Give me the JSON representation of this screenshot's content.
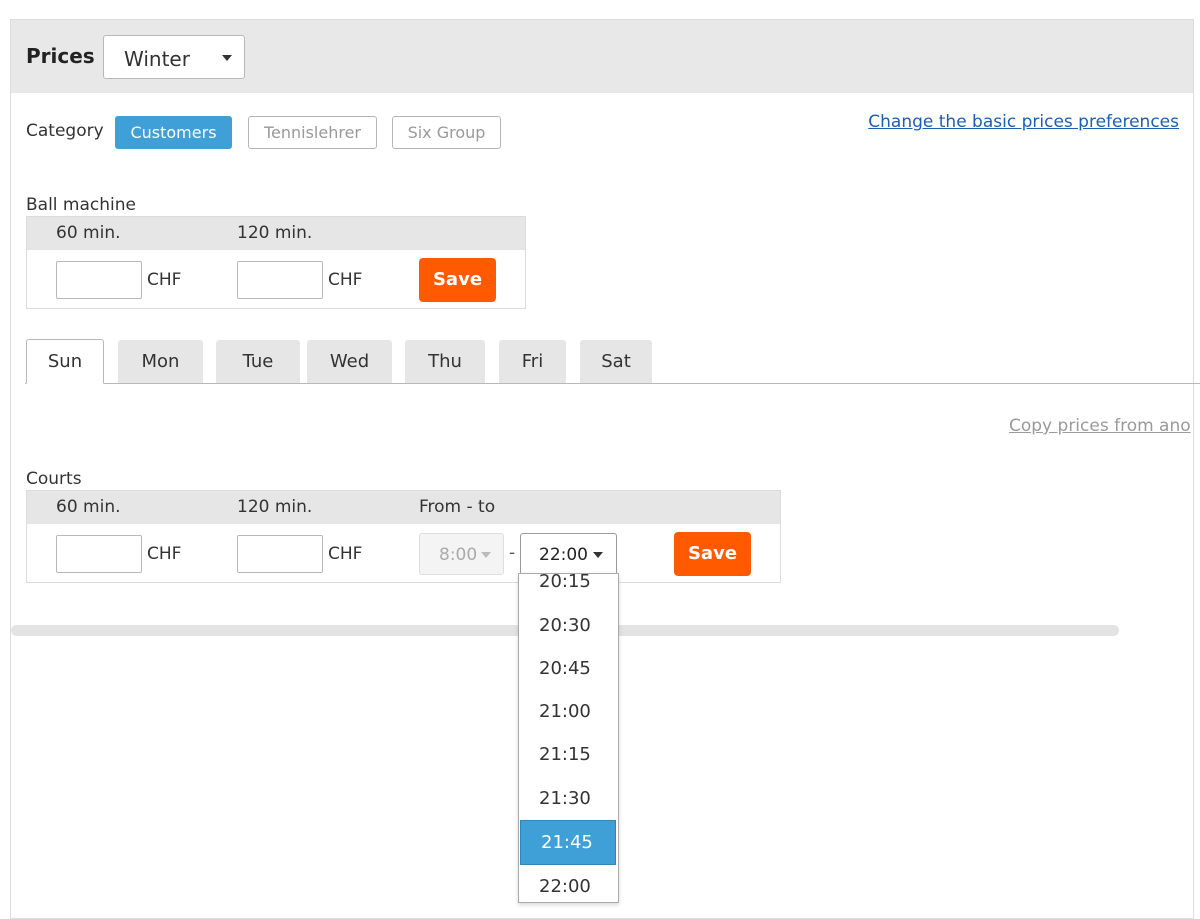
{
  "header": {
    "title": "Prices",
    "season_value": "Winter"
  },
  "category": {
    "label": "Category",
    "buttons": [
      {
        "label": "Customers",
        "active": true
      },
      {
        "label": "Tennislehrer",
        "active": false
      },
      {
        "label": "Six Group",
        "active": false
      }
    ]
  },
  "preferences_link": "Change the basic prices preferences",
  "ball_machine": {
    "title": "Ball machine",
    "col_60": "60 min.",
    "col_120": "120 min.",
    "price_60": "",
    "price_120": "",
    "currency": "CHF",
    "save_label": "Save"
  },
  "tabs": [
    {
      "label": "Sun",
      "active": true
    },
    {
      "label": "Mon",
      "active": false
    },
    {
      "label": "Tue",
      "active": false
    },
    {
      "label": "Wed",
      "active": false
    },
    {
      "label": "Thu",
      "active": false
    },
    {
      "label": "Fri",
      "active": false
    },
    {
      "label": "Sat",
      "active": false
    }
  ],
  "copy_link": "Copy prices from ano",
  "courts": {
    "title": "Courts",
    "col_60": "60 min.",
    "col_120": "120 min.",
    "col_from_to": "From - to",
    "price_60": "",
    "price_120": "",
    "currency": "CHF",
    "from_value": "8:00",
    "dash": "-",
    "to_value": "22:00",
    "save_label": "Save"
  },
  "time_dropdown": {
    "options": [
      "20:15",
      "20:30",
      "20:45",
      "21:00",
      "21:15",
      "21:30",
      "21:45",
      "22:00"
    ],
    "highlighted": "21:45"
  },
  "colors": {
    "accent_blue": "#3ea0d6",
    "save_orange": "#ff5a00",
    "link_blue": "#1a5fb4"
  }
}
